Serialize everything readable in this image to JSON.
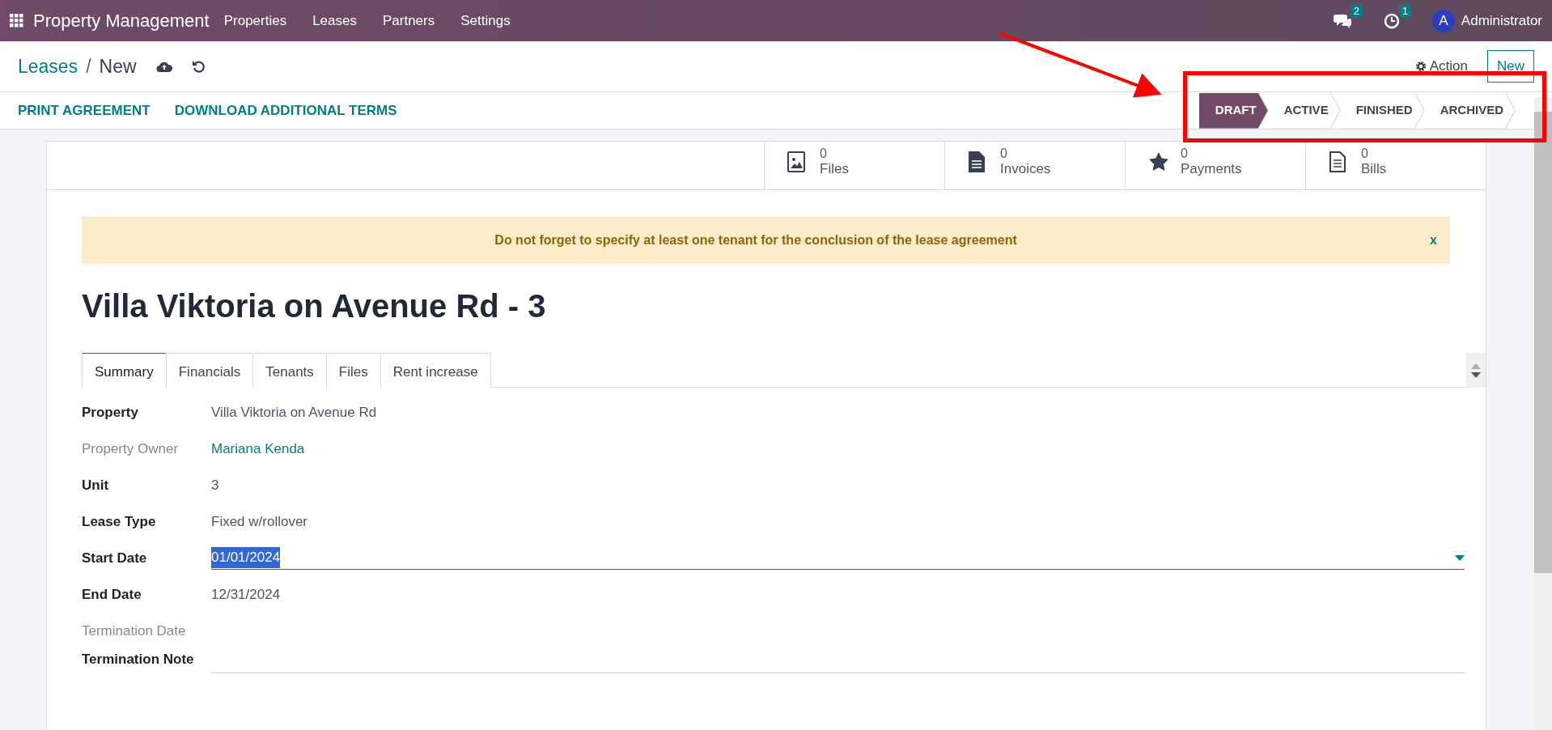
{
  "navbar": {
    "app_name": "Property Management",
    "menu": [
      "Properties",
      "Leases",
      "Partners",
      "Settings"
    ],
    "messages_count": "2",
    "activities_count": "1",
    "user_initial": "A",
    "user_name": "Administrator"
  },
  "breadcrumb": {
    "parent": "Leases",
    "separator": "/",
    "current": "New"
  },
  "action_label": "Action",
  "new_label": "New",
  "header_buttons": [
    "PRINT AGREEMENT",
    "DOWNLOAD ADDITIONAL TERMS"
  ],
  "stages": [
    {
      "label": "DRAFT",
      "selected": true
    },
    {
      "label": "ACTIVE",
      "selected": false
    },
    {
      "label": "FINISHED",
      "selected": false
    },
    {
      "label": "ARCHIVED",
      "selected": false
    }
  ],
  "stat_buttons": [
    {
      "kind": "image",
      "count": "0",
      "label": "Files"
    },
    {
      "kind": "document",
      "count": "0",
      "label": "Invoices"
    },
    {
      "kind": "star",
      "count": "0",
      "label": "Payments"
    },
    {
      "kind": "lines",
      "count": "0",
      "label": "Bills"
    }
  ],
  "alert": {
    "text": "Do not forget to specify at least one tenant for the conclusion of the lease agreement",
    "close": "x"
  },
  "title": "Villa Viktoria on Avenue Rd - 3",
  "tabs": [
    {
      "label": "Summary",
      "selected": true
    },
    {
      "label": "Financials",
      "selected": false
    },
    {
      "label": "Tenants",
      "selected": false
    },
    {
      "label": "Files",
      "selected": false
    },
    {
      "label": "Rent increase",
      "selected": false
    }
  ],
  "fields": [
    {
      "label": "Property",
      "readonly": false,
      "kind": "text",
      "value": "Villa Viktoria on Avenue Rd"
    },
    {
      "label": "Property Owner",
      "readonly": true,
      "kind": "link",
      "value": "Mariana Kenda"
    },
    {
      "label": "Unit",
      "readonly": false,
      "kind": "text",
      "value": "3"
    },
    {
      "label": "Lease Type",
      "readonly": false,
      "kind": "text",
      "value": "Fixed w/rollover"
    },
    {
      "label": "Start Date",
      "readonly": false,
      "kind": "date-input",
      "value": "01/01/2024"
    },
    {
      "label": "End Date",
      "readonly": false,
      "kind": "text",
      "value": "12/31/2024"
    },
    {
      "label": "Termination Date",
      "readonly": true,
      "kind": "empty"
    },
    {
      "label": "Termination Note",
      "readonly": false,
      "kind": "textarea"
    }
  ]
}
